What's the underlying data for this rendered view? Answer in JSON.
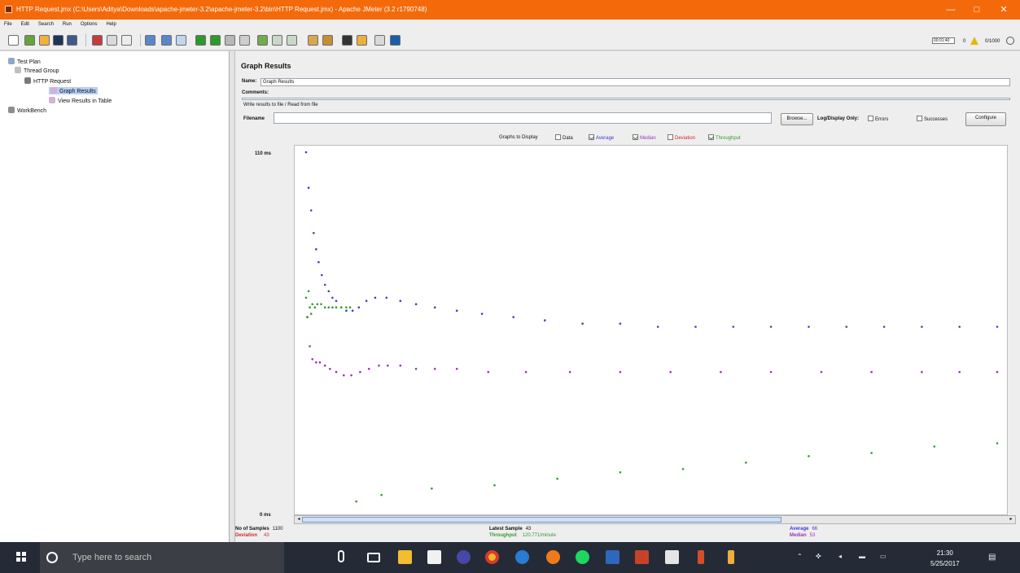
{
  "window": {
    "title": "HTTP Request.jmx (C:\\Users\\Aditya\\Downloads\\apache-jmeter-3.2\\apache-jmeter-3.2\\bin\\HTTP Request.jmx) - Apache JMeter (3.2 r1790748)",
    "buttons": [
      "—",
      "□",
      "✕"
    ]
  },
  "menu": [
    "File",
    "Edit",
    "Search",
    "Run",
    "Options",
    "Help"
  ],
  "toolbar": {
    "timer": "00:01:40",
    "warning_count": "0",
    "threads": "0/1000"
  },
  "tree": {
    "test_plan": "Test Plan",
    "thread_group": "Thread Group",
    "http_request": "HTTP Request",
    "graph_results": "Graph Results",
    "view_results_table": "View Results in Table",
    "workbench": "WorkBench"
  },
  "panel": {
    "title": "Graph Results",
    "name_label": "Name:",
    "name_value": "Graph Results",
    "comments_label": "Comments:",
    "file_section": "Write results to file / Read from file",
    "filename_label": "Filename",
    "browse_label": "Browse...",
    "log_display_label": "Log/Display Only:",
    "errors_label": "Errors",
    "successes_label": "Successes",
    "configure_label": "Configure"
  },
  "graphs": {
    "label": "Graphs to Display",
    "options": [
      {
        "label": "Data",
        "checked": false,
        "color": "#000000"
      },
      {
        "label": "Average",
        "checked": true,
        "color": "#3b3bd6"
      },
      {
        "label": "Median",
        "checked": true,
        "color": "#9c34b3"
      },
      {
        "label": "Deviation",
        "checked": false,
        "color": "#cf2b2b"
      },
      {
        "label": "Throughput",
        "checked": true,
        "color": "#2f9b2f"
      }
    ]
  },
  "stats": {
    "samples_label": "No of Samples",
    "samples_value": "1100",
    "deviation_label": "Deviation",
    "deviation_value": "43",
    "latest_label": "Latest Sample",
    "latest_value": "43",
    "throughput_label": "Throughput",
    "throughput_value": "120.771/minute",
    "average_label": "Average",
    "average_value": "66",
    "median_label": "Median",
    "median_value": "53"
  },
  "chart_data": {
    "type": "scatter",
    "ylabel_top": "110 ms",
    "ylabel_bottom": "0 ms",
    "ylim": [
      0,
      110
    ],
    "series": [
      {
        "name": "Average",
        "color": "#3b3bd6",
        "x": [
          0,
          4,
          8,
          12,
          16,
          20,
          25,
          30,
          36,
          42,
          48,
          56,
          64,
          74,
          84,
          96,
          110,
          128,
          150,
          175,
          205,
          240,
          280,
          330,
          380,
          440,
          500,
          560,
          620,
          680,
          740,
          800,
          860,
          920,
          980,
          1040,
          1100
        ],
        "y": [
          110,
          99,
          92,
          85,
          80,
          76,
          72,
          69,
          67,
          65,
          64,
          62,
          61,
          61,
          62,
          64,
          65,
          65,
          64,
          63,
          62,
          61,
          60,
          59,
          58,
          57,
          57,
          56,
          56,
          56,
          56,
          56,
          56,
          56,
          56,
          56,
          56
        ]
      },
      {
        "name": "Median",
        "color": "#9c34b3",
        "x": [
          2,
          6,
          10,
          16,
          22,
          30,
          38,
          48,
          60,
          72,
          86,
          100,
          116,
          130,
          150,
          175,
          205,
          240,
          290,
          350,
          420,
          500,
          580,
          660,
          740,
          820,
          900,
          980,
          1040,
          1100
        ],
        "y": [
          59,
          50,
          46,
          45,
          45,
          44,
          43,
          42,
          41,
          41,
          42,
          43,
          44,
          44,
          44,
          43,
          43,
          43,
          42,
          42,
          42,
          42,
          42,
          42,
          42,
          42,
          42,
          42,
          42,
          42
        ]
      },
      {
        "name": "Throughput",
        "color": "#2f9b2f",
        "x": [
          0,
          2,
          4,
          6,
          8,
          10,
          14,
          18,
          24,
          30,
          36,
          42,
          48,
          56,
          64,
          70,
          80,
          120,
          200,
          300,
          400,
          500,
          600,
          700,
          800,
          900,
          1000,
          1100
        ],
        "y": [
          65,
          59,
          67,
          62,
          60,
          63,
          62,
          63,
          63,
          62,
          62,
          62,
          62,
          62,
          62,
          62,
          2,
          4,
          6,
          7,
          9,
          11,
          12,
          14,
          16,
          17,
          19,
          20
        ]
      }
    ]
  },
  "taskbar": {
    "search_placeholder": "Type here to search",
    "time": "21:30",
    "date": "5/25/2017"
  }
}
